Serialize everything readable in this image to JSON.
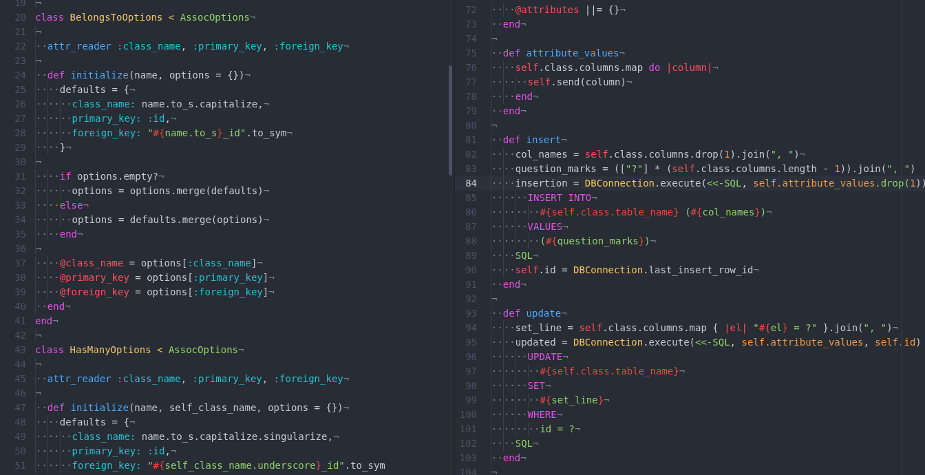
{
  "left_pane": {
    "lines": [
      {
        "number": "19",
        "tokens": [
          {
            "kind": "eol",
            "text": "¬"
          }
        ]
      },
      {
        "number": "20",
        "tokens": [
          {
            "kind": "kw",
            "text": "class"
          },
          {
            "kind": "cls",
            "text": " BelongsToOptions <"
          },
          {
            "kind": "sup",
            "text": " AssocOptions"
          },
          {
            "kind": "eol",
            "text": "¬"
          }
        ]
      },
      {
        "number": "21",
        "tokens": [
          {
            "kind": "eol",
            "text": "¬"
          }
        ]
      },
      {
        "number": "22",
        "tokens": [
          {
            "kind": "ws",
            "text": "··"
          },
          {
            "kind": "fn",
            "text": "attr_reader"
          },
          {
            "kind": "sym",
            "text": " :class_name"
          },
          {
            "kind": "txt",
            "text": ","
          },
          {
            "kind": "sym",
            "text": " :primary_key"
          },
          {
            "kind": "txt",
            "text": ","
          },
          {
            "kind": "sym",
            "text": " :foreign_key"
          },
          {
            "kind": "eol",
            "text": "¬"
          }
        ]
      },
      {
        "number": "23",
        "tokens": [
          {
            "kind": "eol",
            "text": "¬"
          }
        ]
      },
      {
        "number": "24",
        "tokens": [
          {
            "kind": "ws",
            "text": "··"
          },
          {
            "kind": "kw",
            "text": "def"
          },
          {
            "kind": "fn",
            "text": " initialize"
          },
          {
            "kind": "txt",
            "text": "(name, options = {})"
          },
          {
            "kind": "eol",
            "text": "¬"
          }
        ]
      },
      {
        "number": "25",
        "tokens": [
          {
            "kind": "ws",
            "text": "····"
          },
          {
            "kind": "txt",
            "text": "defaults = {"
          },
          {
            "kind": "eol",
            "text": "¬"
          }
        ]
      },
      {
        "number": "26",
        "tokens": [
          {
            "kind": "ws",
            "text": "······"
          },
          {
            "kind": "sym",
            "text": "class_name:"
          },
          {
            "kind": "txt",
            "text": " name.to_s.capitalize,"
          },
          {
            "kind": "eol",
            "text": "¬"
          }
        ]
      },
      {
        "number": "27",
        "tokens": [
          {
            "kind": "ws",
            "text": "······"
          },
          {
            "kind": "sym",
            "text": "primary_key:"
          },
          {
            "kind": "sym",
            "text": " :id"
          },
          {
            "kind": "txt",
            "text": ","
          },
          {
            "kind": "eol",
            "text": "¬"
          }
        ]
      },
      {
        "number": "28",
        "tokens": [
          {
            "kind": "ws",
            "text": "······"
          },
          {
            "kind": "sym",
            "text": "foreign_key:"
          },
          {
            "kind": "str",
            "text": " \""
          },
          {
            "kind": "intp",
            "text": "#{"
          },
          {
            "kind": "str",
            "text": "name.to_s"
          },
          {
            "kind": "intp",
            "text": "}"
          },
          {
            "kind": "str",
            "text": "_id\""
          },
          {
            "kind": "txt",
            "text": ".to_sym"
          },
          {
            "kind": "eol",
            "text": "¬"
          }
        ]
      },
      {
        "number": "29",
        "tokens": [
          {
            "kind": "ws",
            "text": "····"
          },
          {
            "kind": "txt",
            "text": "}"
          },
          {
            "kind": "eol",
            "text": "¬"
          }
        ]
      },
      {
        "number": "30",
        "tokens": [
          {
            "kind": "eol",
            "text": "¬"
          }
        ]
      },
      {
        "number": "31",
        "tokens": [
          {
            "kind": "ws",
            "text": "····"
          },
          {
            "kind": "kw",
            "text": "if"
          },
          {
            "kind": "txt",
            "text": " options.empty?"
          },
          {
            "kind": "eol",
            "text": "¬"
          }
        ]
      },
      {
        "number": "32",
        "tokens": [
          {
            "kind": "ws",
            "text": "······"
          },
          {
            "kind": "txt",
            "text": "options = options.merge(defaults)"
          },
          {
            "kind": "eol",
            "text": "¬"
          }
        ]
      },
      {
        "number": "33",
        "tokens": [
          {
            "kind": "ws",
            "text": "····"
          },
          {
            "kind": "kw",
            "text": "else"
          },
          {
            "kind": "eol",
            "text": "¬"
          }
        ]
      },
      {
        "number": "34",
        "tokens": [
          {
            "kind": "ws",
            "text": "······"
          },
          {
            "kind": "txt",
            "text": "options = defaults.merge(options)"
          },
          {
            "kind": "eol",
            "text": "¬"
          }
        ]
      },
      {
        "number": "35",
        "tokens": [
          {
            "kind": "ws",
            "text": "····"
          },
          {
            "kind": "kw",
            "text": "end"
          },
          {
            "kind": "eol",
            "text": "¬"
          }
        ]
      },
      {
        "number": "36",
        "tokens": [
          {
            "kind": "eol",
            "text": "¬"
          }
        ]
      },
      {
        "number": "37",
        "tokens": [
          {
            "kind": "ws",
            "text": "····"
          },
          {
            "kind": "ivar",
            "text": "@class_name"
          },
          {
            "kind": "txt",
            "text": " = options["
          },
          {
            "kind": "sym",
            "text": ":class_name"
          },
          {
            "kind": "txt",
            "text": "]"
          },
          {
            "kind": "eol",
            "text": "¬"
          }
        ]
      },
      {
        "number": "38",
        "tokens": [
          {
            "kind": "ws",
            "text": "····"
          },
          {
            "kind": "ivar",
            "text": "@primary_key"
          },
          {
            "kind": "txt",
            "text": " = options["
          },
          {
            "kind": "sym",
            "text": ":primary_key"
          },
          {
            "kind": "txt",
            "text": "]"
          },
          {
            "kind": "eol",
            "text": "¬"
          }
        ]
      },
      {
        "number": "39",
        "tokens": [
          {
            "kind": "ws",
            "text": "····"
          },
          {
            "kind": "ivar",
            "text": "@foreign_key"
          },
          {
            "kind": "txt",
            "text": " = options["
          },
          {
            "kind": "sym",
            "text": ":foreign_key"
          },
          {
            "kind": "txt",
            "text": "]"
          },
          {
            "kind": "eol",
            "text": "¬"
          }
        ]
      },
      {
        "number": "40",
        "tokens": [
          {
            "kind": "ws",
            "text": "··"
          },
          {
            "kind": "kw",
            "text": "end"
          },
          {
            "kind": "eol",
            "text": "¬"
          }
        ]
      },
      {
        "number": "41",
        "tokens": [
          {
            "kind": "kw",
            "text": "end"
          },
          {
            "kind": "eol",
            "text": "¬"
          }
        ]
      },
      {
        "number": "42",
        "tokens": [
          {
            "kind": "eol",
            "text": "¬"
          }
        ]
      },
      {
        "number": "43",
        "tokens": [
          {
            "kind": "kw",
            "text": "class"
          },
          {
            "kind": "cls",
            "text": " HasManyOptions <"
          },
          {
            "kind": "sup",
            "text": " AssocOptions"
          },
          {
            "kind": "eol",
            "text": "¬"
          }
        ]
      },
      {
        "number": "44",
        "tokens": [
          {
            "kind": "eol",
            "text": "¬"
          }
        ]
      },
      {
        "number": "45",
        "tokens": [
          {
            "kind": "ws",
            "text": "··"
          },
          {
            "kind": "fn",
            "text": "attr_reader"
          },
          {
            "kind": "sym",
            "text": " :class_name"
          },
          {
            "kind": "txt",
            "text": ","
          },
          {
            "kind": "sym",
            "text": " :primary_key"
          },
          {
            "kind": "txt",
            "text": ","
          },
          {
            "kind": "sym",
            "text": " :foreign_key"
          },
          {
            "kind": "eol",
            "text": "¬"
          }
        ]
      },
      {
        "number": "46",
        "tokens": [
          {
            "kind": "eol",
            "text": "¬"
          }
        ]
      },
      {
        "number": "47",
        "tokens": [
          {
            "kind": "ws",
            "text": "··"
          },
          {
            "kind": "kw",
            "text": "def"
          },
          {
            "kind": "fn",
            "text": " initialize"
          },
          {
            "kind": "txt",
            "text": "(name, self_class_name, options = {})"
          },
          {
            "kind": "eol",
            "text": "¬"
          }
        ]
      },
      {
        "number": "48",
        "tokens": [
          {
            "kind": "ws",
            "text": "····"
          },
          {
            "kind": "txt",
            "text": "defaults = {"
          },
          {
            "kind": "eol",
            "text": "¬"
          }
        ]
      },
      {
        "number": "49",
        "tokens": [
          {
            "kind": "ws",
            "text": "······"
          },
          {
            "kind": "sym",
            "text": "class_name:"
          },
          {
            "kind": "txt",
            "text": " name.to_s.capitalize.singularize,"
          },
          {
            "kind": "eol",
            "text": "¬"
          }
        ]
      },
      {
        "number": "50",
        "tokens": [
          {
            "kind": "ws",
            "text": "······"
          },
          {
            "kind": "sym",
            "text": "primary_key:"
          },
          {
            "kind": "sym",
            "text": " :id"
          },
          {
            "kind": "txt",
            "text": ","
          },
          {
            "kind": "eol",
            "text": "¬"
          }
        ]
      },
      {
        "number": "51",
        "tokens": [
          {
            "kind": "ws",
            "text": "······"
          },
          {
            "kind": "sym",
            "text": "foreign_key:"
          },
          {
            "kind": "str",
            "text": " \""
          },
          {
            "kind": "intp",
            "text": "#{"
          },
          {
            "kind": "str",
            "text": "self_class_name.underscore"
          },
          {
            "kind": "intp",
            "text": "}"
          },
          {
            "kind": "str",
            "text": "_id\""
          },
          {
            "kind": "txt",
            "text": ".to_sym"
          }
        ]
      }
    ]
  },
  "right_pane": {
    "lines": [
      {
        "number": "72",
        "current": false,
        "tokens": [
          {
            "kind": "ws",
            "text": "····"
          },
          {
            "kind": "ivar",
            "text": "@attributes"
          },
          {
            "kind": "txt",
            "text": " ||= {}"
          },
          {
            "kind": "eol",
            "text": "¬"
          }
        ]
      },
      {
        "number": "73",
        "current": false,
        "tokens": [
          {
            "kind": "ws",
            "text": "··"
          },
          {
            "kind": "kw",
            "text": "end"
          },
          {
            "kind": "eol",
            "text": "¬"
          }
        ]
      },
      {
        "number": "74",
        "current": false,
        "tokens": [
          {
            "kind": "eol",
            "text": "¬"
          }
        ]
      },
      {
        "number": "75",
        "current": false,
        "tokens": [
          {
            "kind": "ws",
            "text": "··"
          },
          {
            "kind": "kw",
            "text": "def"
          },
          {
            "kind": "fn",
            "text": " attribute_values"
          },
          {
            "kind": "eol",
            "text": "¬"
          }
        ]
      },
      {
        "number": "76",
        "current": false,
        "tokens": [
          {
            "kind": "ws",
            "text": "····"
          },
          {
            "kind": "self",
            "text": "self"
          },
          {
            "kind": "txt",
            "text": ".class.columns.map"
          },
          {
            "kind": "kw",
            "text": " do"
          },
          {
            "kind": "self",
            "text": " |column|"
          },
          {
            "kind": "eol",
            "text": "¬"
          }
        ]
      },
      {
        "number": "77",
        "current": false,
        "tokens": [
          {
            "kind": "ws",
            "text": "······"
          },
          {
            "kind": "self",
            "text": "self"
          },
          {
            "kind": "txt",
            "text": ".send(column)"
          },
          {
            "kind": "eol",
            "text": "¬"
          }
        ]
      },
      {
        "number": "78",
        "current": false,
        "tokens": [
          {
            "kind": "ws",
            "text": "····"
          },
          {
            "kind": "kw",
            "text": "end"
          },
          {
            "kind": "eol",
            "text": "¬"
          }
        ]
      },
      {
        "number": "79",
        "current": false,
        "tokens": [
          {
            "kind": "ws",
            "text": "··"
          },
          {
            "kind": "kw",
            "text": "end"
          },
          {
            "kind": "eol",
            "text": "¬"
          }
        ]
      },
      {
        "number": "80",
        "current": false,
        "tokens": [
          {
            "kind": "eol",
            "text": "¬"
          }
        ]
      },
      {
        "number": "81",
        "current": false,
        "tokens": [
          {
            "kind": "ws",
            "text": "··"
          },
          {
            "kind": "kw",
            "text": "def"
          },
          {
            "kind": "fn",
            "text": " insert"
          },
          {
            "kind": "eol",
            "text": "¬"
          }
        ]
      },
      {
        "number": "82",
        "current": false,
        "tokens": [
          {
            "kind": "ws",
            "text": "····"
          },
          {
            "kind": "txt",
            "text": "col_names ="
          },
          {
            "kind": "self",
            "text": " self"
          },
          {
            "kind": "txt",
            "text": ".class.columns.drop("
          },
          {
            "kind": "num",
            "text": "1"
          },
          {
            "kind": "txt",
            "text": ").join("
          },
          {
            "kind": "str",
            "text": "\", \""
          },
          {
            "kind": "txt",
            "text": ")"
          },
          {
            "kind": "eol",
            "text": "¬"
          }
        ]
      },
      {
        "number": "83",
        "current": false,
        "tokens": [
          {
            "kind": "ws",
            "text": "····"
          },
          {
            "kind": "txt",
            "text": "question_marks = (["
          },
          {
            "kind": "str",
            "text": "\"?\""
          },
          {
            "kind": "txt",
            "text": "] * ("
          },
          {
            "kind": "self",
            "text": "self"
          },
          {
            "kind": "txt",
            "text": ".class.columns.length -"
          },
          {
            "kind": "num",
            "text": " 1"
          },
          {
            "kind": "txt",
            "text": ")).join("
          },
          {
            "kind": "str",
            "text": "\", \""
          },
          {
            "kind": "txt",
            "text": ")"
          }
        ]
      },
      {
        "number": "84",
        "current": true,
        "tokens": [
          {
            "kind": "ws",
            "text": "····"
          },
          {
            "kind": "txt",
            "text": "insertion ="
          },
          {
            "kind": "const",
            "text": " DBConnection"
          },
          {
            "kind": "txt",
            "text": ".execute("
          },
          {
            "kind": "str",
            "text": "<<-SQL"
          },
          {
            "kind": "txt",
            "text": ","
          },
          {
            "kind": "arg",
            "text": " self.attribute_values"
          },
          {
            "kind": "str",
            "text": ".drop("
          },
          {
            "kind": "num",
            "text": "1"
          },
          {
            "kind": "txt",
            "text": "))"
          }
        ]
      },
      {
        "number": "85",
        "current": false,
        "tokens": [
          {
            "kind": "ws",
            "text": "······"
          },
          {
            "kind": "kw",
            "text": "INSERT INTO"
          },
          {
            "kind": "eol",
            "text": "¬"
          }
        ]
      },
      {
        "number": "86",
        "current": false,
        "tokens": [
          {
            "kind": "ws",
            "text": "········"
          },
          {
            "kind": "intp",
            "text": "#{self.class.table_name}"
          },
          {
            "kind": "str",
            "text": " ("
          },
          {
            "kind": "intp",
            "text": "#{"
          },
          {
            "kind": "str",
            "text": "col_names"
          },
          {
            "kind": "intp",
            "text": "}"
          },
          {
            "kind": "str",
            "text": ")"
          },
          {
            "kind": "eol",
            "text": "¬"
          }
        ]
      },
      {
        "number": "87",
        "current": false,
        "tokens": [
          {
            "kind": "ws",
            "text": "······"
          },
          {
            "kind": "kw",
            "text": "VALUES"
          },
          {
            "kind": "eol",
            "text": "¬"
          }
        ]
      },
      {
        "number": "88",
        "current": false,
        "tokens": [
          {
            "kind": "ws",
            "text": "········"
          },
          {
            "kind": "str",
            "text": "("
          },
          {
            "kind": "intp",
            "text": "#{"
          },
          {
            "kind": "str",
            "text": "question_marks"
          },
          {
            "kind": "intp",
            "text": "}"
          },
          {
            "kind": "str",
            "text": ")"
          },
          {
            "kind": "eol",
            "text": "¬"
          }
        ]
      },
      {
        "number": "89",
        "current": false,
        "tokens": [
          {
            "kind": "ws",
            "text": "····"
          },
          {
            "kind": "str",
            "text": "SQL"
          },
          {
            "kind": "eol",
            "text": "¬"
          }
        ]
      },
      {
        "number": "90",
        "current": false,
        "tokens": [
          {
            "kind": "ws",
            "text": "····"
          },
          {
            "kind": "self",
            "text": "self"
          },
          {
            "kind": "txt",
            "text": ".id ="
          },
          {
            "kind": "const",
            "text": " DBConnection"
          },
          {
            "kind": "txt",
            "text": ".last_insert_row_id"
          },
          {
            "kind": "eol",
            "text": "¬"
          }
        ]
      },
      {
        "number": "91",
        "current": false,
        "tokens": [
          {
            "kind": "ws",
            "text": "··"
          },
          {
            "kind": "kw",
            "text": "end"
          },
          {
            "kind": "eol",
            "text": "¬"
          }
        ]
      },
      {
        "number": "92",
        "current": false,
        "tokens": [
          {
            "kind": "eol",
            "text": "¬"
          }
        ]
      },
      {
        "number": "93",
        "current": false,
        "tokens": [
          {
            "kind": "ws",
            "text": "··"
          },
          {
            "kind": "kw",
            "text": "def"
          },
          {
            "kind": "fn",
            "text": " update"
          },
          {
            "kind": "eol",
            "text": "¬"
          }
        ]
      },
      {
        "number": "94",
        "current": false,
        "tokens": [
          {
            "kind": "ws",
            "text": "····"
          },
          {
            "kind": "txt",
            "text": "set_line ="
          },
          {
            "kind": "self",
            "text": " self"
          },
          {
            "kind": "txt",
            "text": ".class.columns.map {"
          },
          {
            "kind": "self",
            "text": " |el|"
          },
          {
            "kind": "str",
            "text": " \""
          },
          {
            "kind": "intp",
            "text": "#{"
          },
          {
            "kind": "str",
            "text": "el"
          },
          {
            "kind": "intp",
            "text": "}"
          },
          {
            "kind": "str",
            "text": " = ?\""
          },
          {
            "kind": "txt",
            "text": " }.join("
          },
          {
            "kind": "str",
            "text": "\", \""
          },
          {
            "kind": "txt",
            "text": ")"
          },
          {
            "kind": "eol",
            "text": "¬"
          }
        ]
      },
      {
        "number": "95",
        "current": false,
        "tokens": [
          {
            "kind": "ws",
            "text": "····"
          },
          {
            "kind": "txt",
            "text": "updated ="
          },
          {
            "kind": "const",
            "text": " DBConnection"
          },
          {
            "kind": "txt",
            "text": ".execute("
          },
          {
            "kind": "str",
            "text": "<<-SQL"
          },
          {
            "kind": "txt",
            "text": ","
          },
          {
            "kind": "arg",
            "text": " self.attribute_values"
          },
          {
            "kind": "txt",
            "text": ","
          },
          {
            "kind": "arg",
            "text": " self.id"
          },
          {
            "kind": "txt",
            "text": ")"
          }
        ]
      },
      {
        "number": "96",
        "current": false,
        "tokens": [
          {
            "kind": "ws",
            "text": "······"
          },
          {
            "kind": "kw",
            "text": "UPDATE"
          },
          {
            "kind": "eol",
            "text": "¬"
          }
        ]
      },
      {
        "number": "97",
        "current": false,
        "tokens": [
          {
            "kind": "ws",
            "text": "········"
          },
          {
            "kind": "intp",
            "text": "#{self.class.table_name}"
          },
          {
            "kind": "eol",
            "text": "¬"
          }
        ]
      },
      {
        "number": "98",
        "current": false,
        "tokens": [
          {
            "kind": "ws",
            "text": "······"
          },
          {
            "kind": "kw",
            "text": "SET"
          },
          {
            "kind": "eol",
            "text": "¬"
          }
        ]
      },
      {
        "number": "99",
        "current": false,
        "tokens": [
          {
            "kind": "ws",
            "text": "········"
          },
          {
            "kind": "intp",
            "text": "#{"
          },
          {
            "kind": "str",
            "text": "set_line"
          },
          {
            "kind": "intp",
            "text": "}"
          },
          {
            "kind": "eol",
            "text": "¬"
          }
        ]
      },
      {
        "number": "100",
        "current": false,
        "tokens": [
          {
            "kind": "ws",
            "text": "······"
          },
          {
            "kind": "kw",
            "text": "WHERE"
          },
          {
            "kind": "eol",
            "text": "¬"
          }
        ]
      },
      {
        "number": "101",
        "current": false,
        "tokens": [
          {
            "kind": "ws",
            "text": "········"
          },
          {
            "kind": "str",
            "text": "id = ?"
          },
          {
            "kind": "eol",
            "text": "¬"
          }
        ]
      },
      {
        "number": "102",
        "current": false,
        "tokens": [
          {
            "kind": "ws",
            "text": "····"
          },
          {
            "kind": "str",
            "text": "SQL"
          },
          {
            "kind": "eol",
            "text": "¬"
          }
        ]
      },
      {
        "number": "103",
        "current": false,
        "tokens": [
          {
            "kind": "ws",
            "text": "··"
          },
          {
            "kind": "kw",
            "text": "end"
          },
          {
            "kind": "eol",
            "text": "¬"
          }
        ]
      },
      {
        "number": "104",
        "current": false,
        "tokens": [
          {
            "kind": "eol",
            "text": "¬"
          }
        ]
      }
    ]
  }
}
